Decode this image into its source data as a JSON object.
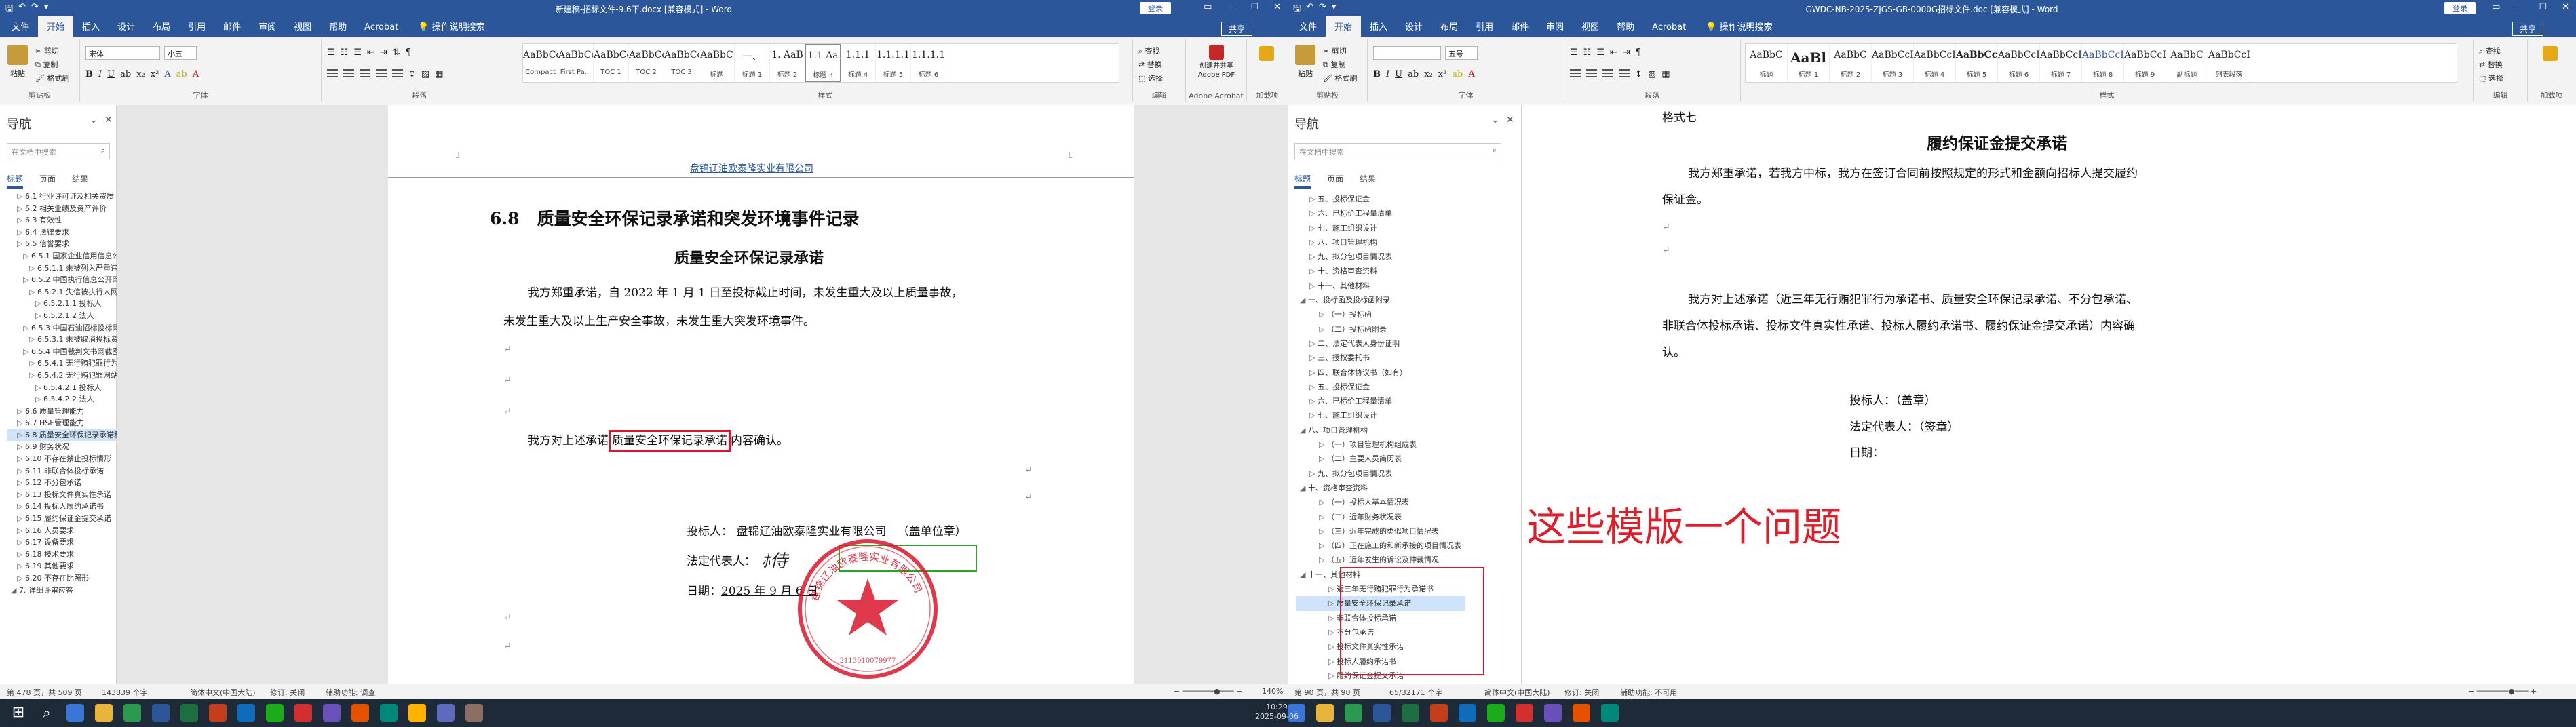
{
  "win1": {
    "title": "新建稿-招标文件-9.6下.docx [兼容模式] - Word",
    "signin": "登录",
    "share": "共享",
    "tabs": [
      "文件",
      "开始",
      "插入",
      "设计",
      "布局",
      "引用",
      "邮件",
      "审阅",
      "视图",
      "帮助",
      "Acrobat"
    ],
    "tellme": "操作说明搜索",
    "ribbon": {
      "paste": "粘贴",
      "cut": "剪切",
      "copy": "复制",
      "painter": "格式刷",
      "clipboard": "剪贴板",
      "font_name": "宋体",
      "font_size": "小五",
      "font": "字体",
      "paragraph": "段落",
      "styles_label": "样式",
      "find": "查找",
      "replace": "替换",
      "select": "选择",
      "editing": "编辑",
      "pdf": "创建并共享 Adobe PDF",
      "acrobat": "Adobe Acrobat",
      "addin": "加载项",
      "styles": [
        {
          "prev": "AaBbCcDd",
          "name": "Compact"
        },
        {
          "prev": "AaBbCcDd",
          "name": "First Pa..."
        },
        {
          "prev": "AaBbCcDd",
          "name": "TOC 1"
        },
        {
          "prev": "AaBbCcDd",
          "name": "TOC 2"
        },
        {
          "prev": "AaBbCcDd",
          "name": "TOC 3"
        },
        {
          "prev": "AaBbC",
          "name": "标题"
        },
        {
          "prev": "一、",
          "name": "标题 1"
        },
        {
          "prev": "1. AaB",
          "name": "标题 2"
        },
        {
          "prev": "1.1 Aa",
          "name": "标题 3"
        },
        {
          "prev": "1.1.1",
          "name": "标题 4"
        },
        {
          "prev": "1.1.1.1",
          "name": "标题 5"
        },
        {
          "prev": "1.1.1.1",
          "name": "标题 6"
        }
      ]
    },
    "nav": {
      "title": "导航",
      "search_placeholder": "在文档中搜索",
      "tabs": [
        "标题",
        "页面",
        "结果"
      ],
      "items": [
        {
          "text": "6.1 行业许可证及相关资质",
          "lvl": 1,
          "sel": false
        },
        {
          "text": "6.2 相关业绩及资产评价",
          "lvl": 1,
          "sel": false
        },
        {
          "text": "6.3 有效性",
          "lvl": 1,
          "sel": false
        },
        {
          "text": "6.4 法律要求",
          "lvl": 1,
          "sel": false
        },
        {
          "text": "6.5 信誉要求",
          "lvl": 1,
          "sel": false
        },
        {
          "text": "6.5.1 国家企业信用信息公示系统截图",
          "lvl": 2,
          "sel": false
        },
        {
          "text": "6.5.1.1 未被列入严重违法失信企业名单",
          "lvl": 3,
          "sel": false
        },
        {
          "text": "6.5.2 中国执行信息公开网截图",
          "lvl": 2,
          "sel": false
        },
        {
          "text": "6.5.2.1 失信被执行人网页查询信息",
          "lvl": 3,
          "sel": false
        },
        {
          "text": "6.5.2.1.1 投标人",
          "lvl": 4,
          "sel": false
        },
        {
          "text": "6.5.2.1.2 法人",
          "lvl": 4,
          "sel": false
        },
        {
          "text": "6.5.3 中国石油招标投标网截图",
          "lvl": 2,
          "sel": false
        },
        {
          "text": "6.5.3.1 未被取消投标资格",
          "lvl": 3,
          "sel": false
        },
        {
          "text": "6.5.4 中国裁判文书网截图及承诺",
          "lvl": 2,
          "sel": false
        },
        {
          "text": "6.5.4.1 无行贿犯罪行为承诺",
          "lvl": 3,
          "sel": false
        },
        {
          "text": "6.5.4.2 无行贿犯罪网站查询截图",
          "lvl": 3,
          "sel": false
        },
        {
          "text": "6.5.4.2.1 投标人",
          "lvl": 4,
          "sel": false
        },
        {
          "text": "6.5.4.2.2 法人",
          "lvl": 4,
          "sel": false
        },
        {
          "text": "6.6 质量管理能力",
          "lvl": 1,
          "sel": false
        },
        {
          "text": "6.7 HSE管理能力",
          "lvl": 1,
          "sel": false
        },
        {
          "text": "6.8 质量安全环保记录承诺和突发环境事件记录",
          "lvl": 1,
          "sel": true
        },
        {
          "text": "6.9 财务状况",
          "lvl": 1,
          "sel": false
        },
        {
          "text": "6.10 不存在禁止投标情形",
          "lvl": 1,
          "sel": false
        },
        {
          "text": "6.11 非联合体投标承诺",
          "lvl": 1,
          "sel": false
        },
        {
          "text": "6.12 不分包承诺",
          "lvl": 1,
          "sel": false
        },
        {
          "text": "6.13 投标文件真实性承诺",
          "lvl": 1,
          "sel": false
        },
        {
          "text": "6.14 投标人履约承诺书",
          "lvl": 1,
          "sel": false
        },
        {
          "text": "6.15 履约保证金提交承诺",
          "lvl": 1,
          "sel": false
        },
        {
          "text": "6.16 人员要求",
          "lvl": 1,
          "sel": false
        },
        {
          "text": "6.17 设备要求",
          "lvl": 1,
          "sel": false
        },
        {
          "text": "6.18 技术要求",
          "lvl": 1,
          "sel": false
        },
        {
          "text": "6.19 其他要求",
          "lvl": 1,
          "sel": false
        },
        {
          "text": "6.20 不存在比照形",
          "lvl": 1,
          "sel": false
        },
        {
          "text": "7. 详细评审应答",
          "lvl": 0,
          "sel": false
        }
      ]
    },
    "doc": {
      "header": "盘锦辽油欧泰隆实业有限公司",
      "heading_num": "6.8",
      "heading": "质量安全环保记录承诺和突发环境事件记录",
      "subtitle": "质量安全环保记录承诺",
      "p1a": "我方郑重承诺，自 2022 年 1 月 1 日至投标截止时间，未发生重大及以上质量事故，",
      "p1b": "未发生重大及以上生产安全事故，未发生重大突发环境事件。",
      "p2_pre": "我方对上述承诺",
      "p2_box": "质量安全环保记录承诺",
      "p2_post": "内容确认。",
      "bidder_label": "投标人：",
      "bidder_name": "盘锦辽油欧泰隆实业有限公司",
      "bidder_seal": "（盖单位章）",
      "legal_label": "法定代表人：",
      "date_label": "日期：",
      "date_value": "2025 年 9 月 6 日",
      "stamp_text": "盘锦辽油欧泰隆实业有限公司",
      "stamp_code": "2113010079977"
    },
    "status": {
      "page": "第 478 页，共 509 页",
      "words": "143839 个字",
      "lang": "简体中文(中国大陆)",
      "track": "修订: 关闭",
      "access": "辅助功能: 调查",
      "zoom": "140%"
    }
  },
  "win2": {
    "title": "GWDC-NB-2025-ZJGS-GB-0000G招标文件.doc [兼容模式] - Word",
    "signin": "登录",
    "share": "共享",
    "tabs": [
      "文件",
      "开始",
      "插入",
      "设计",
      "布局",
      "引用",
      "邮件",
      "审阅",
      "视图",
      "帮助",
      "Acrobat"
    ],
    "tellme": "操作说明搜索",
    "ribbon": {
      "paste": "粘贴",
      "cut": "剪切",
      "copy": "复制",
      "painter": "格式刷",
      "clipboard": "剪贴板",
      "font_size": "五号",
      "font": "字体",
      "paragraph": "段落",
      "styles_label": "样式",
      "find": "查找",
      "replace": "替换",
      "select": "选择",
      "editing": "编辑",
      "addin": "加载项",
      "styles": [
        {
          "prev": "AaBbC",
          "name": "标题"
        },
        {
          "prev": "AaBl",
          "name": "标题 1"
        },
        {
          "prev": "AaBbC",
          "name": "标题 2"
        },
        {
          "prev": "AaBbCcI",
          "name": "标题 3"
        },
        {
          "prev": "AaBbCcD",
          "name": "标题 4"
        },
        {
          "prev": "AaBbCcD",
          "name": "标题 5"
        },
        {
          "prev": "AaBbCcD",
          "name": "标题 6"
        },
        {
          "prev": "AaBbCcD",
          "name": "标题 7"
        },
        {
          "prev": "AaBbCcD",
          "name": "标题 8"
        },
        {
          "prev": "AaBbCcD",
          "name": "标题 9"
        },
        {
          "prev": "AaBbC",
          "name": "副标题"
        },
        {
          "prev": "AaBbCcDd",
          "name": "列表段落"
        }
      ]
    },
    "nav": {
      "title": "导航",
      "search_placeholder": "在文档中搜索",
      "tabs": [
        "标题",
        "页面",
        "结果"
      ],
      "items": [
        {
          "text": "五、投标保证金",
          "lvl": 1,
          "sel": false
        },
        {
          "text": "六、已标价工程量清单",
          "lvl": 1,
          "sel": false
        },
        {
          "text": "七、施工组织设计",
          "lvl": 1,
          "sel": false
        },
        {
          "text": "八、项目管理机构",
          "lvl": 1,
          "sel": false
        },
        {
          "text": "九、拟分包项目情况表",
          "lvl": 1,
          "sel": false
        },
        {
          "text": "十、资格审查资料",
          "lvl": 1,
          "sel": false
        },
        {
          "text": "十一、其他材料",
          "lvl": 1,
          "sel": false
        },
        {
          "text": "一、投标函及投标函附录",
          "lvl": 0,
          "sel": false
        },
        {
          "text": "（一）投标函",
          "lvl": 2,
          "sel": false
        },
        {
          "text": "（二）投标函附录",
          "lvl": 2,
          "sel": false
        },
        {
          "text": "二、法定代表人身份证明",
          "lvl": 1,
          "sel": false
        },
        {
          "text": "三、授权委托书",
          "lvl": 1,
          "sel": false
        },
        {
          "text": "四、联合体协议书（如有）",
          "lvl": 1,
          "sel": false
        },
        {
          "text": "五、投标保证金",
          "lvl": 1,
          "sel": false
        },
        {
          "text": "六、已标价工程量清单",
          "lvl": 1,
          "sel": false
        },
        {
          "text": "七、施工组织设计",
          "lvl": 1,
          "sel": false
        },
        {
          "text": "八、项目管理机构",
          "lvl": 0,
          "sel": false
        },
        {
          "text": "（一）项目管理机构组成表",
          "lvl": 2,
          "sel": false
        },
        {
          "text": "（二）主要人员简历表",
          "lvl": 2,
          "sel": false
        },
        {
          "text": "九、拟分包项目情况表",
          "lvl": 1,
          "sel": false
        },
        {
          "text": "十、资格审查资料",
          "lvl": 0,
          "sel": false
        },
        {
          "text": "（一）投标人基本情况表",
          "lvl": 2,
          "sel": false
        },
        {
          "text": "（二）近年财务状况表",
          "lvl": 2,
          "sel": false
        },
        {
          "text": "（三）近年完成的类似项目情况表",
          "lvl": 2,
          "sel": false
        },
        {
          "text": "（四）正在施工的和新承接的项目情况表",
          "lvl": 2,
          "sel": false
        },
        {
          "text": "（五）近年发生的诉讼及仲裁情况",
          "lvl": 2,
          "sel": false
        },
        {
          "text": "十一、其他材料",
          "lvl": 0,
          "sel": false
        },
        {
          "text": "近三年无行贿犯罪行为承诺书",
          "lvl": 3,
          "sel": false
        },
        {
          "text": "质量安全环保记录承诺",
          "lvl": 3,
          "sel": true
        },
        {
          "text": "非联合体投标承诺",
          "lvl": 3,
          "sel": false
        },
        {
          "text": "不分包承诺",
          "lvl": 3,
          "sel": false
        },
        {
          "text": "投标文件真实性承诺",
          "lvl": 3,
          "sel": false
        },
        {
          "text": "投标人履约承诺书",
          "lvl": 3,
          "sel": false
        },
        {
          "text": "履约保证金提交承诺",
          "lvl": 3,
          "sel": false
        }
      ]
    },
    "doc": {
      "format_label": "格式七",
      "title": "履约保证金提交承诺",
      "p1a": "我方郑重承诺，若我方中标，我方在签订合同前按照规定的形式和金额向招标人提交履约",
      "p1b": "保证金。",
      "p2a": "我方对上述承诺（近三年无行贿犯罪行为承诺书、质量安全环保记录承诺、不分包承诺、",
      "p2b": "非联合体投标承诺、投标文件真实性承诺、投标人履约承诺书、履约保证金提交承诺）内容确",
      "p2c": "认。",
      "bidder": "投标人：（盖章）",
      "legal": "法定代表人：（签章）",
      "date": "日期："
    },
    "status": {
      "page": "第 90 页，共 90 页",
      "words": "65/32171 个字",
      "lang": "简体中文(中国大陆)",
      "track": "修订: 关闭",
      "access": "辅助功能: 不可用"
    }
  },
  "annotation": "这些模版一个问题",
  "taskbar": {
    "time": "10:29",
    "date": "2025-09-06"
  }
}
